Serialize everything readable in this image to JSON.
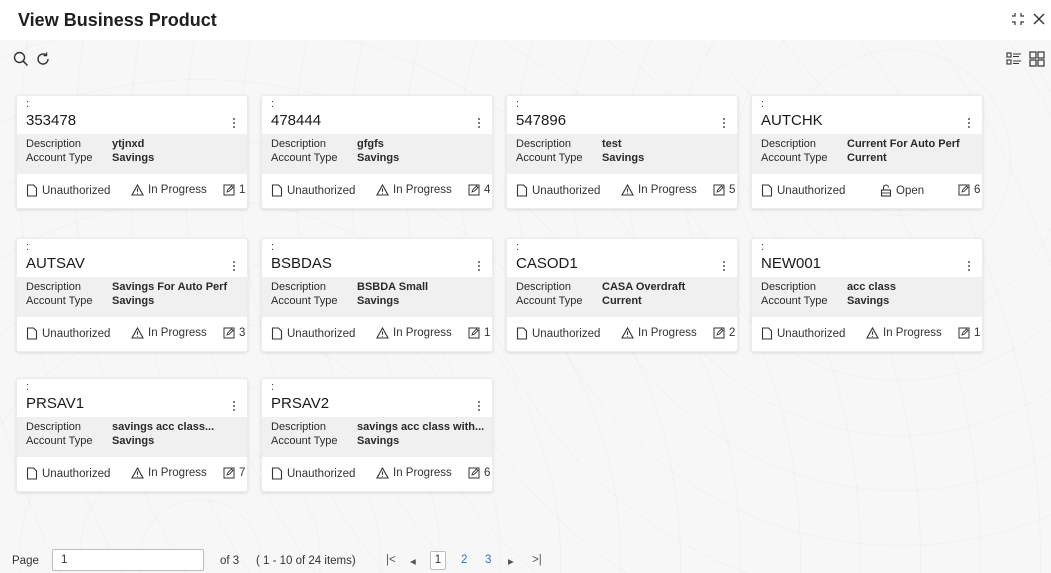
{
  "header": {
    "title": "View Business Product"
  },
  "card_labels": {
    "colon": ":",
    "description_key": "Description",
    "account_type_key": "Account Type"
  },
  "cards": [
    {
      "code": "353478",
      "description": "ytjnxd",
      "account_type": "Savings",
      "auth_status": "Unauthorized",
      "status": "In Progress",
      "status_icon": "warning-icon",
      "edits": "1"
    },
    {
      "code": "478444",
      "description": "gfgfs",
      "account_type": "Savings",
      "auth_status": "Unauthorized",
      "status": "In Progress",
      "status_icon": "warning-icon",
      "edits": "4"
    },
    {
      "code": "547896",
      "description": "test",
      "account_type": "Savings",
      "auth_status": "Unauthorized",
      "status": "In Progress",
      "status_icon": "warning-icon",
      "edits": "5"
    },
    {
      "code": "AUTCHK",
      "description": "Current For Auto Perf",
      "account_type": "Current",
      "auth_status": "Unauthorized",
      "status": "Open",
      "status_icon": "unlock-icon",
      "edits": "6"
    },
    {
      "code": "AUTSAV",
      "description": "Savings For Auto Perf",
      "account_type": "Savings",
      "auth_status": "Unauthorized",
      "status": "In Progress",
      "status_icon": "warning-icon",
      "edits": "3"
    },
    {
      "code": "BSBDAS",
      "description": "BSBDA Small",
      "account_type": "Savings",
      "auth_status": "Unauthorized",
      "status": "In Progress",
      "status_icon": "warning-icon",
      "edits": "1"
    },
    {
      "code": "CASOD1",
      "description": "CASA Overdraft",
      "account_type": "Current",
      "auth_status": "Unauthorized",
      "status": "In Progress",
      "status_icon": "warning-icon",
      "edits": "2"
    },
    {
      "code": "NEW001",
      "description": "acc class",
      "account_type": "Savings",
      "auth_status": "Unauthorized",
      "status": "In Progress",
      "status_icon": "warning-icon",
      "edits": "1"
    },
    {
      "code": "PRSAV1",
      "description": "savings acc class...",
      "account_type": "Savings",
      "auth_status": "Unauthorized",
      "status": "In Progress",
      "status_icon": "warning-icon",
      "edits": "7"
    },
    {
      "code": "PRSAV2",
      "description": "savings acc class with...",
      "account_type": "Savings",
      "auth_status": "Unauthorized",
      "status": "In Progress",
      "status_icon": "warning-icon",
      "edits": "6"
    }
  ],
  "pagination": {
    "page_label": "Page",
    "page_value": "1",
    "of_text": "of 3",
    "items_text": "( 1 - 10 of 24 items)",
    "first": "|<",
    "prev": "◂",
    "current": "1",
    "pages": [
      "2",
      "3"
    ],
    "next": "▸",
    "last": ">|"
  },
  "colors": {
    "link": "#2a6fd6",
    "card_band": "#f0f0f0",
    "background": "#f7f7f7"
  }
}
